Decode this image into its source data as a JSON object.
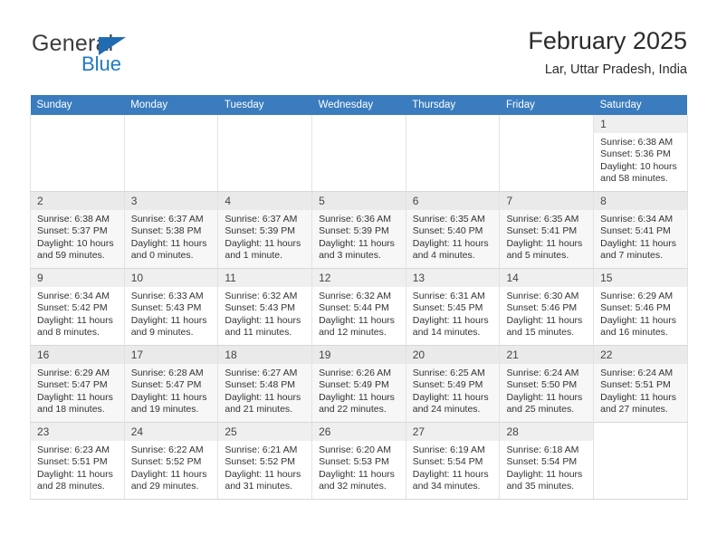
{
  "brand": {
    "name_part1": "General",
    "name_part2": "Blue",
    "triangle_color": "#1f6cb0",
    "blue_color": "#1f7ac4"
  },
  "header": {
    "title": "February 2025",
    "subtitle": "Lar, Uttar Pradesh, India"
  },
  "theme": {
    "header_row_bg": "#3a7cbe",
    "header_row_text": "#ffffff",
    "daynum_bg": "#efefef",
    "alt_row_bg": "#f7f7f7",
    "grid_border": "#e2e2e2"
  },
  "weekday_headers": [
    "Sunday",
    "Monday",
    "Tuesday",
    "Wednesday",
    "Thursday",
    "Friday",
    "Saturday"
  ],
  "labels": {
    "sunrise_prefix": "Sunrise:",
    "sunset_prefix": "Sunset:",
    "daylight_prefix": "Daylight:"
  },
  "weeks": [
    {
      "alt": false,
      "days": [
        {
          "empty": true
        },
        {
          "empty": true
        },
        {
          "empty": true
        },
        {
          "empty": true
        },
        {
          "empty": true
        },
        {
          "empty": true
        },
        {
          "empty": false,
          "day": "1",
          "sunrise": "Sunrise: 6:38 AM",
          "sunset": "Sunset: 5:36 PM",
          "daylight_line1": "Daylight: 10 hours",
          "daylight_line2": "and 58 minutes."
        }
      ]
    },
    {
      "alt": true,
      "days": [
        {
          "empty": false,
          "day": "2",
          "sunrise": "Sunrise: 6:38 AM",
          "sunset": "Sunset: 5:37 PM",
          "daylight_line1": "Daylight: 10 hours",
          "daylight_line2": "and 59 minutes."
        },
        {
          "empty": false,
          "day": "3",
          "sunrise": "Sunrise: 6:37 AM",
          "sunset": "Sunset: 5:38 PM",
          "daylight_line1": "Daylight: 11 hours",
          "daylight_line2": "and 0 minutes."
        },
        {
          "empty": false,
          "day": "4",
          "sunrise": "Sunrise: 6:37 AM",
          "sunset": "Sunset: 5:39 PM",
          "daylight_line1": "Daylight: 11 hours",
          "daylight_line2": "and 1 minute."
        },
        {
          "empty": false,
          "day": "5",
          "sunrise": "Sunrise: 6:36 AM",
          "sunset": "Sunset: 5:39 PM",
          "daylight_line1": "Daylight: 11 hours",
          "daylight_line2": "and 3 minutes."
        },
        {
          "empty": false,
          "day": "6",
          "sunrise": "Sunrise: 6:35 AM",
          "sunset": "Sunset: 5:40 PM",
          "daylight_line1": "Daylight: 11 hours",
          "daylight_line2": "and 4 minutes."
        },
        {
          "empty": false,
          "day": "7",
          "sunrise": "Sunrise: 6:35 AM",
          "sunset": "Sunset: 5:41 PM",
          "daylight_line1": "Daylight: 11 hours",
          "daylight_line2": "and 5 minutes."
        },
        {
          "empty": false,
          "day": "8",
          "sunrise": "Sunrise: 6:34 AM",
          "sunset": "Sunset: 5:41 PM",
          "daylight_line1": "Daylight: 11 hours",
          "daylight_line2": "and 7 minutes."
        }
      ]
    },
    {
      "alt": false,
      "days": [
        {
          "empty": false,
          "day": "9",
          "sunrise": "Sunrise: 6:34 AM",
          "sunset": "Sunset: 5:42 PM",
          "daylight_line1": "Daylight: 11 hours",
          "daylight_line2": "and 8 minutes."
        },
        {
          "empty": false,
          "day": "10",
          "sunrise": "Sunrise: 6:33 AM",
          "sunset": "Sunset: 5:43 PM",
          "daylight_line1": "Daylight: 11 hours",
          "daylight_line2": "and 9 minutes."
        },
        {
          "empty": false,
          "day": "11",
          "sunrise": "Sunrise: 6:32 AM",
          "sunset": "Sunset: 5:43 PM",
          "daylight_line1": "Daylight: 11 hours",
          "daylight_line2": "and 11 minutes."
        },
        {
          "empty": false,
          "day": "12",
          "sunrise": "Sunrise: 6:32 AM",
          "sunset": "Sunset: 5:44 PM",
          "daylight_line1": "Daylight: 11 hours",
          "daylight_line2": "and 12 minutes."
        },
        {
          "empty": false,
          "day": "13",
          "sunrise": "Sunrise: 6:31 AM",
          "sunset": "Sunset: 5:45 PM",
          "daylight_line1": "Daylight: 11 hours",
          "daylight_line2": "and 14 minutes."
        },
        {
          "empty": false,
          "day": "14",
          "sunrise": "Sunrise: 6:30 AM",
          "sunset": "Sunset: 5:46 PM",
          "daylight_line1": "Daylight: 11 hours",
          "daylight_line2": "and 15 minutes."
        },
        {
          "empty": false,
          "day": "15",
          "sunrise": "Sunrise: 6:29 AM",
          "sunset": "Sunset: 5:46 PM",
          "daylight_line1": "Daylight: 11 hours",
          "daylight_line2": "and 16 minutes."
        }
      ]
    },
    {
      "alt": true,
      "days": [
        {
          "empty": false,
          "day": "16",
          "sunrise": "Sunrise: 6:29 AM",
          "sunset": "Sunset: 5:47 PM",
          "daylight_line1": "Daylight: 11 hours",
          "daylight_line2": "and 18 minutes."
        },
        {
          "empty": false,
          "day": "17",
          "sunrise": "Sunrise: 6:28 AM",
          "sunset": "Sunset: 5:47 PM",
          "daylight_line1": "Daylight: 11 hours",
          "daylight_line2": "and 19 minutes."
        },
        {
          "empty": false,
          "day": "18",
          "sunrise": "Sunrise: 6:27 AM",
          "sunset": "Sunset: 5:48 PM",
          "daylight_line1": "Daylight: 11 hours",
          "daylight_line2": "and 21 minutes."
        },
        {
          "empty": false,
          "day": "19",
          "sunrise": "Sunrise: 6:26 AM",
          "sunset": "Sunset: 5:49 PM",
          "daylight_line1": "Daylight: 11 hours",
          "daylight_line2": "and 22 minutes."
        },
        {
          "empty": false,
          "day": "20",
          "sunrise": "Sunrise: 6:25 AM",
          "sunset": "Sunset: 5:49 PM",
          "daylight_line1": "Daylight: 11 hours",
          "daylight_line2": "and 24 minutes."
        },
        {
          "empty": false,
          "day": "21",
          "sunrise": "Sunrise: 6:24 AM",
          "sunset": "Sunset: 5:50 PM",
          "daylight_line1": "Daylight: 11 hours",
          "daylight_line2": "and 25 minutes."
        },
        {
          "empty": false,
          "day": "22",
          "sunrise": "Sunrise: 6:24 AM",
          "sunset": "Sunset: 5:51 PM",
          "daylight_line1": "Daylight: 11 hours",
          "daylight_line2": "and 27 minutes."
        }
      ]
    },
    {
      "alt": false,
      "days": [
        {
          "empty": false,
          "day": "23",
          "sunrise": "Sunrise: 6:23 AM",
          "sunset": "Sunset: 5:51 PM",
          "daylight_line1": "Daylight: 11 hours",
          "daylight_line2": "and 28 minutes."
        },
        {
          "empty": false,
          "day": "24",
          "sunrise": "Sunrise: 6:22 AM",
          "sunset": "Sunset: 5:52 PM",
          "daylight_line1": "Daylight: 11 hours",
          "daylight_line2": "and 29 minutes."
        },
        {
          "empty": false,
          "day": "25",
          "sunrise": "Sunrise: 6:21 AM",
          "sunset": "Sunset: 5:52 PM",
          "daylight_line1": "Daylight: 11 hours",
          "daylight_line2": "and 31 minutes."
        },
        {
          "empty": false,
          "day": "26",
          "sunrise": "Sunrise: 6:20 AM",
          "sunset": "Sunset: 5:53 PM",
          "daylight_line1": "Daylight: 11 hours",
          "daylight_line2": "and 32 minutes."
        },
        {
          "empty": false,
          "day": "27",
          "sunrise": "Sunrise: 6:19 AM",
          "sunset": "Sunset: 5:54 PM",
          "daylight_line1": "Daylight: 11 hours",
          "daylight_line2": "and 34 minutes."
        },
        {
          "empty": false,
          "day": "28",
          "sunrise": "Sunrise: 6:18 AM",
          "sunset": "Sunset: 5:54 PM",
          "daylight_line1": "Daylight: 11 hours",
          "daylight_line2": "and 35 minutes."
        },
        {
          "empty": true
        }
      ]
    }
  ]
}
